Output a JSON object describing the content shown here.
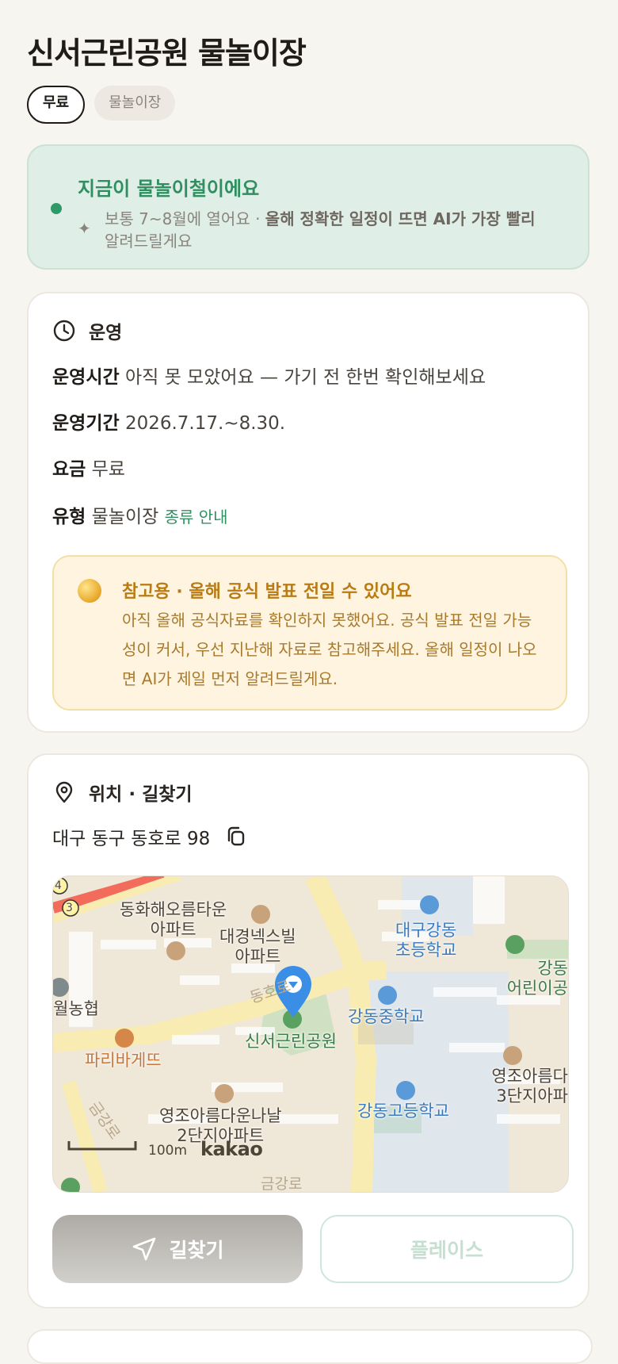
{
  "page": {
    "title": "신서근린공원 물놀이장",
    "chips": [
      "무료",
      "물놀이장"
    ]
  },
  "season": {
    "headline": "지금이 물놀이철이에요",
    "sub_prefix": "보통 7~8월에 열어요 · ",
    "sub_bold": "올해 정확한 일정이 뜨면 AI가 가장 빨리",
    "sub_suffix": "알려드릴게요",
    "spark_icon": "sparkle-icon",
    "accent": "#2f9a68"
  },
  "operation": {
    "section_title": "운영",
    "icon": "clock-icon",
    "rows": [
      {
        "key": "운영시간",
        "value": "아직 못 모았어요 — 가기 전 한번 확인해보세요"
      },
      {
        "key": "운영기간",
        "value": "2026.7.17.~8.30."
      },
      {
        "key": "요금",
        "value": "무료"
      },
      {
        "key": "유형",
        "value": "물놀이장",
        "link": "종류 안내"
      }
    ],
    "notice": {
      "title": "참고용 · 올해 공식 발표 전일 수 있어요",
      "body": "아직 올해 공식자료를 확인하지 못했어요. 공식 발표 전일 가능성이 커서, 우선 지난해 자료로 참고해주세요. 올해 일정이 나오면 AI가 제일 먼저 알려드릴게요.",
      "icon": "coin-icon"
    }
  },
  "location": {
    "section_title": "위치 · 길찾기",
    "icon": "location-pin-icon",
    "address": "대구 동구 동호로 98",
    "copy_icon": "copy-icon",
    "map": {
      "labels": {
        "apt1": "동화해오름타운\n아파트",
        "apt2": "대경넥스빌\n아파트",
        "school1": "대구강동\n초등학교",
        "kinder": "강동\n어린이공",
        "bank": "월농협",
        "park": "신서근린공원",
        "school2": "강동중학교",
        "bakery": "파리바게뜨",
        "apt3": "영조아름다운나날\n2단지아파트",
        "school3": "강동고등학교",
        "apt4": "영조아름다\n3단지아파",
        "road1": "동호로",
        "road2": "금강로",
        "road3": "금강로",
        "badge_a": "4",
        "badge_b": "3",
        "scale": "100m",
        "brand": "kakao"
      }
    },
    "buttons": {
      "route": "길찾기",
      "route_icon": "navigation-arrow-icon",
      "place": "플레이스"
    }
  }
}
